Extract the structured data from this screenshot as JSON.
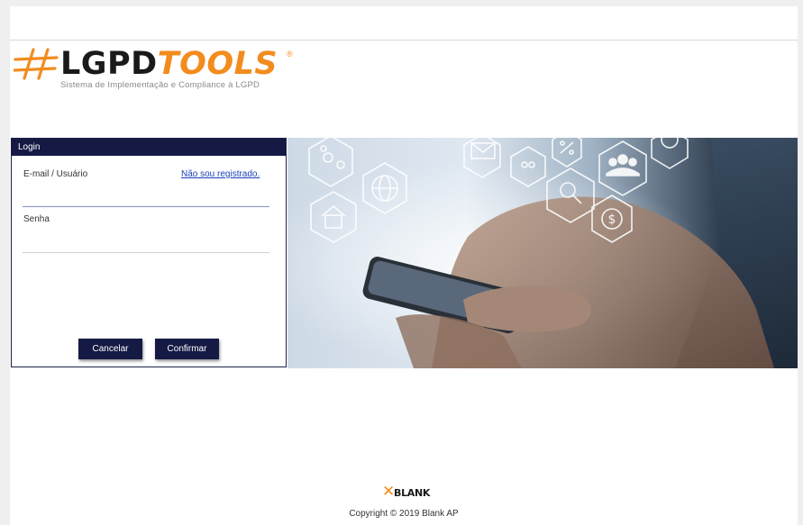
{
  "brand": {
    "name_part1": "LGPD",
    "name_part2": "TOOLS",
    "registered": "®",
    "tagline": "Sistema de Implementação e Compliance à LGPD",
    "orange": "#f28c1e",
    "navy": "#151a45"
  },
  "login": {
    "header": "Login",
    "email_label": "E-mail / Usuário",
    "email_value": "",
    "register_link": "Não sou registrado.",
    "password_label": "Senha",
    "password_value": "",
    "cancel_label": "Cancelar",
    "confirm_label": "Confirmar"
  },
  "hero": {
    "icons": [
      "gears-icon",
      "mail-icon",
      "percent-icon",
      "group-icon",
      "globe-icon",
      "search-icon",
      "home-icon",
      "dollar-icon",
      "people-icon",
      "circle-icon"
    ]
  },
  "footer": {
    "logo_text": "BLANK",
    "copyright": "Copyright © 2019 Blank AP"
  }
}
